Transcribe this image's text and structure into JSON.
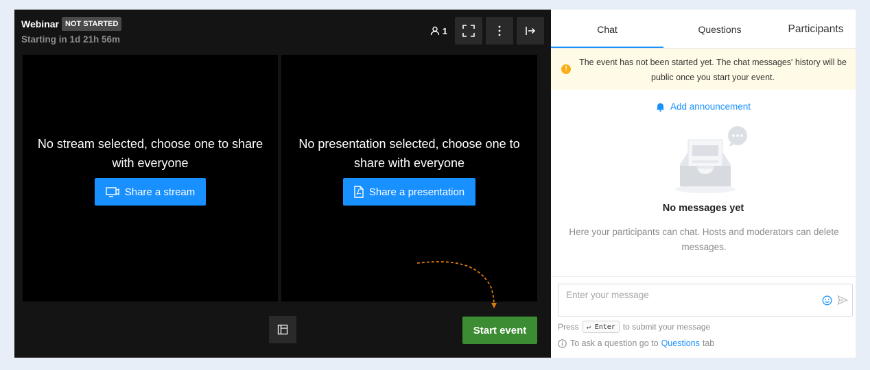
{
  "stage": {
    "title": "Webinar",
    "status_badge": "NOT STARTED",
    "countdown": "Starting in 1d 21h 56m",
    "participant_count": "1",
    "stream_panel": {
      "message": "No stream selected, choose one to share with everyone",
      "button_label": "Share a stream"
    },
    "presentation_panel": {
      "message": "No presentation selected, choose one to share with everyone",
      "button_label": "Share a presentation"
    },
    "start_button_label": "Start event"
  },
  "sidebar": {
    "tabs": [
      {
        "label": "Chat",
        "active": true
      },
      {
        "label": "Questions",
        "active": false
      },
      {
        "label": "Participants",
        "active": false
      }
    ],
    "notice": "The event has not been started yet. The chat messages' history will be public once you start your event.",
    "announce_label": "Add announcement",
    "empty_title": "No messages yet",
    "empty_desc": "Here your participants can chat. Hosts and moderators can delete messages.",
    "input_placeholder": "Enter your message",
    "hint_press": "Press",
    "hint_key": "↵ Enter",
    "hint_suffix": "to submit your message",
    "question_hint_prefix": "To ask a question go to",
    "question_hint_link": "Questions",
    "question_hint_suffix": "tab"
  },
  "colors": {
    "accent": "#1890ff",
    "start_button": "#3b8c32",
    "notice_bg": "#fffbe6",
    "warning": "#faad14"
  },
  "icons": [
    "user-icon",
    "fullscreen-icon",
    "more-icon",
    "exit-icon",
    "share-screen-icon",
    "pdf-file-icon",
    "layout-icon",
    "bell-icon",
    "emoji-icon",
    "send-icon",
    "info-icon",
    "warning-icon"
  ]
}
